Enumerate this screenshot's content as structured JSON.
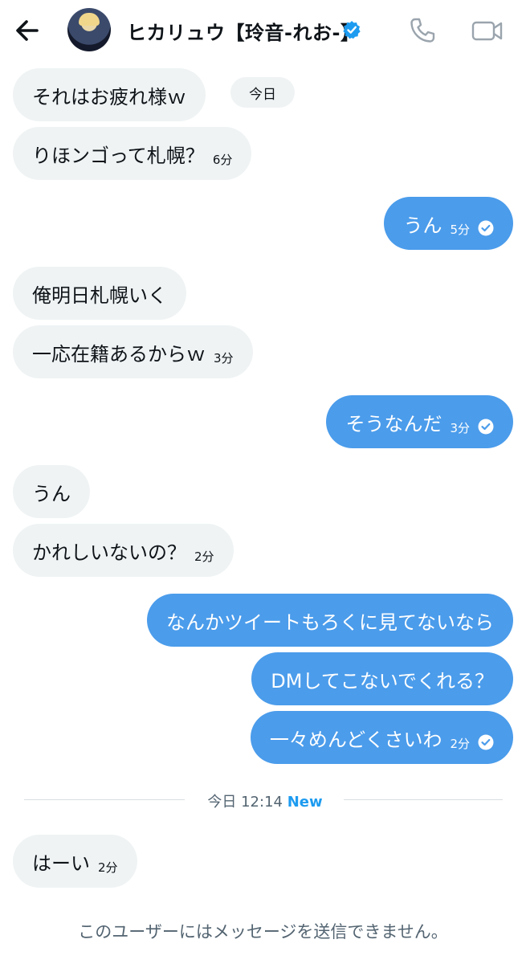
{
  "header": {
    "name": "ヒカリュウ【玲音-れお-】",
    "accent": "#1d9bf0"
  },
  "messages": [
    {
      "text": "それはお疲れ様ｗ",
      "time": ""
    },
    {
      "text": "りほンゴって札幌？",
      "time": "6分"
    },
    {
      "text": "うん",
      "time": "5分"
    },
    {
      "text": "俺明日札幌いく",
      "time": ""
    },
    {
      "text": "一応在籍あるからｗ",
      "time": "3分"
    },
    {
      "text": "そうなんだ",
      "time": "3分"
    },
    {
      "text": "うん",
      "time": ""
    },
    {
      "text": "かれしいないの？",
      "time": "2分"
    },
    {
      "text": "なんかツイートもろくに見てないなら",
      "time": ""
    },
    {
      "text": "DMしてこないでくれる？",
      "time": ""
    },
    {
      "text": "一々めんどくさいわ",
      "time": "2分"
    },
    {
      "text": "はーい",
      "time": "2分"
    }
  ],
  "date_chip": "今日",
  "divider": {
    "label": "今日 12:14",
    "new_label": "New"
  },
  "footer": {
    "text": "このユーザーにはメッセージを送信できません。"
  },
  "colors": {
    "outgoing": "#4b9ceb",
    "incoming": "#eff3f4",
    "divider_new": "#1d9bf0"
  }
}
